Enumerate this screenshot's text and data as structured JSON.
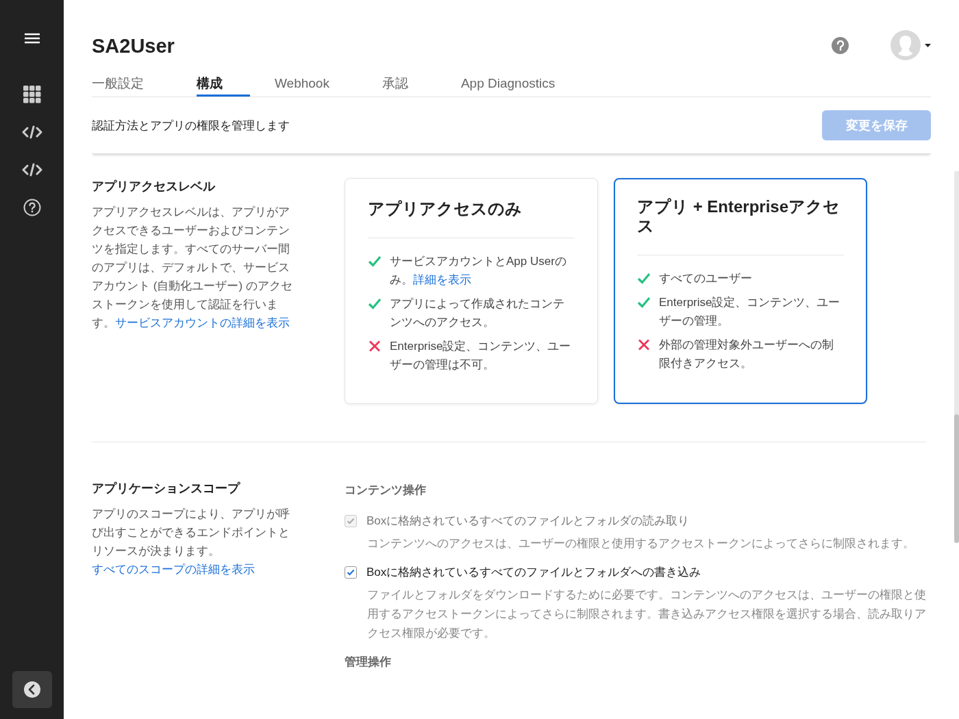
{
  "header": {
    "title": "SA2User"
  },
  "tabs": [
    {
      "label": "一般設定",
      "selected": false
    },
    {
      "label": "構成",
      "selected": true
    },
    {
      "label": "Webhook",
      "selected": false
    },
    {
      "label": "承認",
      "selected": false
    },
    {
      "label": "App Diagnostics",
      "selected": false
    }
  ],
  "subtitle": "認証方法とアプリの権限を管理します",
  "save_button": {
    "label": "変更を保存",
    "disabled": true
  },
  "access_level": {
    "heading": "アプリアクセスレベル",
    "description": {
      "text": "アプリアクセスレベルは、アプリがアクセスできるユーザーおよびコンテンツを指定します。すべてのサーバー間のアプリは、デフォルトで、サービスアカウント (自動化ユーザー) のアクセストークンを使用して認証を行います。",
      "link": "サービスアカウントの詳細を表示"
    },
    "options": [
      {
        "title": "アプリアクセスのみ",
        "selected": false,
        "features": [
          {
            "kind": "check",
            "text": "サービスアカウントとApp Userのみ。",
            "link": "詳細を表示"
          },
          {
            "kind": "check",
            "text": "アプリによって作成されたコンテンツへのアクセス。"
          },
          {
            "kind": "cross",
            "text": "Enterprise設定、コンテンツ、ユーザーの管理は不可。"
          }
        ]
      },
      {
        "title": "アプリ + Enterpriseアクセス",
        "selected": true,
        "features": [
          {
            "kind": "check",
            "text": "すべてのユーザー"
          },
          {
            "kind": "check",
            "text": "Enterprise設定、コンテンツ、ユーザーの管理。"
          },
          {
            "kind": "cross",
            "text": "外部の管理対象外ユーザーへの制限付きアクセス。"
          }
        ]
      }
    ]
  },
  "scopes": {
    "heading": "アプリケーションスコープ",
    "description": {
      "text": "アプリのスコープにより、アプリが呼び出すことができるエンドポイントとリソースが決まります。",
      "link": "すべてのスコープの詳細を表示"
    },
    "groups": [
      {
        "heading": "コンテンツ操作",
        "items": [
          {
            "label": "Boxに格納されているすべてのファイルとフォルダの読み取り",
            "checked": true,
            "disabled": true,
            "help": "コンテンツへのアクセスは、ユーザーの権限と使用するアクセストークンによってさらに制限されます。"
          },
          {
            "label": "Boxに格納されているすべてのファイルとフォルダへの書き込み",
            "checked": true,
            "disabled": false,
            "help": "ファイルとフォルダをダウンロードするために必要です。コンテンツへのアクセスは、ユーザーの権限と使用するアクセストークンによってさらに制限されます。書き込みアクセス権限を選択する場合、読み取りアクセス権限が必要です。"
          }
        ]
      },
      {
        "heading": "管理操作"
      }
    ]
  }
}
